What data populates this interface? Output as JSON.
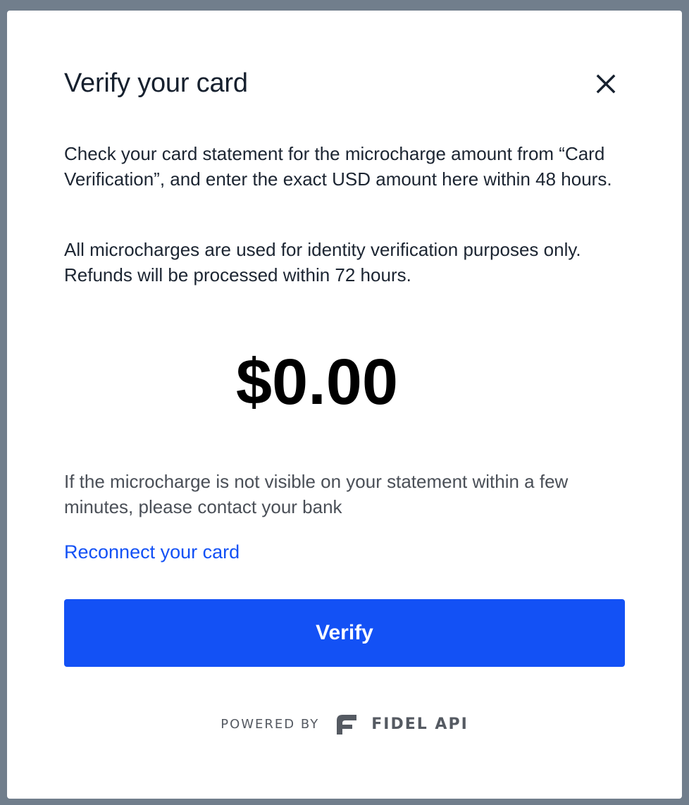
{
  "dialog": {
    "title": "Verify your card",
    "close_icon": "close-icon",
    "instructions": "Check your card statement for the microcharge amount from “Card Verification”, and enter the exact USD amount here within 48 hours.",
    "disclaimer": "All microcharges are used for identity verification purposes only. Refunds will be processed within 72 hours.",
    "amount_value": "$0.00",
    "hint": "If the microcharge is not visible on your statement within a few minutes, please contact your bank",
    "reconnect_link": "Reconnect your card",
    "verify_button": "Verify"
  },
  "footer": {
    "powered_by": "POWERED BY",
    "logo_icon": "fidel-logo-icon",
    "brand": "FIDEL API"
  },
  "colors": {
    "backdrop": "#717e8c",
    "accent": "#1351f5",
    "text_primary": "#16202e",
    "text_secondary": "#4a4f57",
    "footer_gray": "#555a62"
  }
}
